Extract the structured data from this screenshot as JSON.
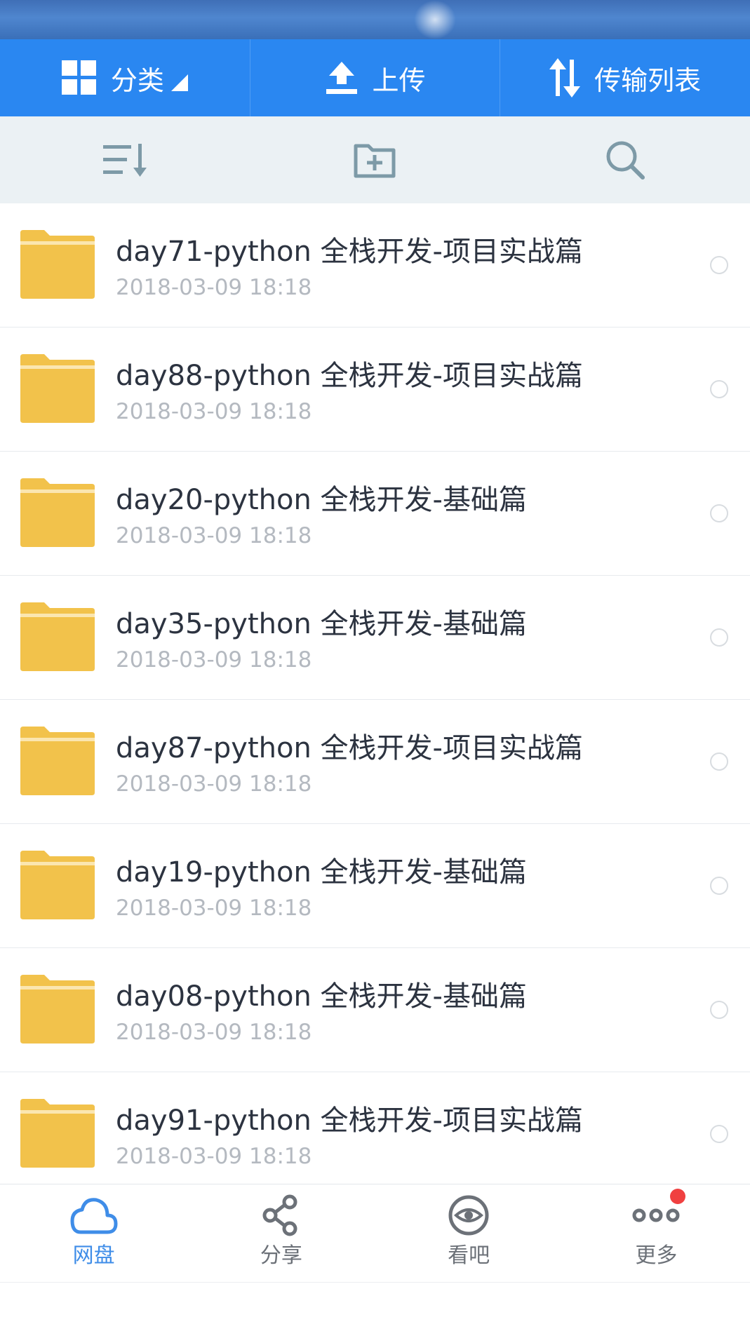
{
  "actionbar": {
    "category_label": "分类",
    "upload_label": "上传",
    "transfer_label": "传输列表"
  },
  "toolbar": {
    "sort_icon": "sort-list-icon",
    "new_folder_icon": "new-folder-icon",
    "search_icon": "search-icon"
  },
  "files": [
    {
      "name": "day71-python 全栈开发-项目实战篇",
      "date": "2018-03-09  18:18"
    },
    {
      "name": "day88-python 全栈开发-项目实战篇",
      "date": "2018-03-09  18:18"
    },
    {
      "name": "day20-python 全栈开发-基础篇",
      "date": "2018-03-09  18:18"
    },
    {
      "name": "day35-python 全栈开发-基础篇",
      "date": "2018-03-09  18:18"
    },
    {
      "name": "day87-python 全栈开发-项目实战篇",
      "date": "2018-03-09  18:18"
    },
    {
      "name": "day19-python 全栈开发-基础篇",
      "date": "2018-03-09  18:18"
    },
    {
      "name": "day08-python 全栈开发-基础篇",
      "date": "2018-03-09  18:18"
    },
    {
      "name": "day91-python 全栈开发-项目实战篇",
      "date": "2018-03-09  18:18"
    }
  ],
  "bottomnav": {
    "items": [
      {
        "label": "网盘",
        "icon": "cloud-icon",
        "active": true
      },
      {
        "label": "分享",
        "icon": "share-icon",
        "active": false
      },
      {
        "label": "看吧",
        "icon": "eye-icon",
        "active": false
      },
      {
        "label": "更多",
        "icon": "more-icon",
        "active": false,
        "badge": true
      }
    ]
  },
  "colors": {
    "action_bar": "#2a87f1",
    "toolbar_bg": "#ebf1f4",
    "folder": "#f2c24b",
    "active_tab": "#3f8de8",
    "badge": "#f04040"
  }
}
